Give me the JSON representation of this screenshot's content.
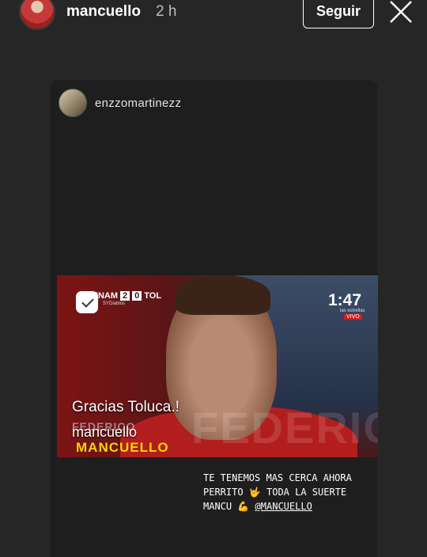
{
  "header": {
    "username": "mancuello",
    "time": "2 h",
    "follow_label": "Seguir",
    "close_icon": "close-icon"
  },
  "repost": {
    "username": "enzzomartinezz"
  },
  "video": {
    "score": {
      "home": "UNAM",
      "home_goals": "2",
      "away_goals": "0",
      "away": "TOL"
    },
    "sponsor": "SYDiablos",
    "game_clock": "1:47",
    "network": "las estrellas",
    "live_badge": "VIVO",
    "caption": "Gracias Toluca.!",
    "caption_handle": "mancuello",
    "ghost_name": "FEDERICO",
    "player_name": "MANCUELLO",
    "watermark": "FEDERICO"
  },
  "story_text": {
    "line1": "TE TENEMOS MAS CERCA AHORA",
    "line2a": "PERRITO",
    "emoji1": "🤟",
    "line2b": "TODA LA SUERTE",
    "line3a": "MANCU",
    "emoji2": "💪",
    "mention": "@MANCUELLO"
  }
}
